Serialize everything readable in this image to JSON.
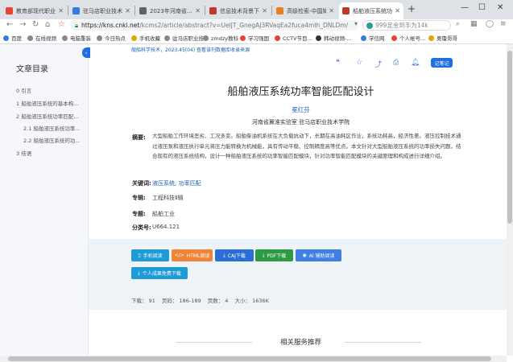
{
  "browser": {
    "tabs": [
      {
        "label": "教育部现代职业教...",
        "color": "#e94235"
      },
      {
        "label": "驻马店职业技术学...",
        "color": "#2f7de1"
      },
      {
        "label": "2023年河南省...",
        "color": "#5f6368"
      },
      {
        "label": "信息技术背景下船...",
        "color": "#c0392b"
      },
      {
        "label": "高级检索-中国知网",
        "color": "#e67e22"
      },
      {
        "label": "船舶液压系统功率...",
        "color": "#c0392b"
      }
    ],
    "new_tab": "+",
    "window_controls": {
      "minimize": "—",
      "maximize": "☐",
      "close": "✕"
    },
    "url_host": "https://kns.cnki.net",
    "url_path": "/kcms2/article/abstract?v=UelJT_GnegAJ3RVaqEa2fuca4mIh_DNLDm/",
    "search_placeholder": "999足金到手为14k",
    "bookmarks": [
      "百度",
      "在线视频",
      "电脑重装",
      "今日热点",
      "手机收藏",
      "驻马店职业技...",
      "zmdzy教科",
      "学习强国",
      "CCTV节目...",
      "韩动视频-...",
      "学信网",
      "个人帐号...",
      "奥瓊哥哥"
    ]
  },
  "sidebar": {
    "title": "文章目录",
    "toc": [
      {
        "label": "0 引言",
        "indent": 0
      },
      {
        "label": "1 船舶液压系统的基本构...",
        "indent": 0
      },
      {
        "label": "2 船舶液压系统功率匹配...",
        "indent": 0
      },
      {
        "label": "2.1 船舶液压系统功率...",
        "indent": 1
      },
      {
        "label": "2.2 船舶液压系统的功...",
        "indent": 1
      },
      {
        "label": "3 结语",
        "indent": 0
      }
    ],
    "collapse_icon": "‹"
  },
  "article": {
    "meta_line": "舰船科学技术，2023,45(04)  查看该刊数据库收录来源",
    "note_button": "记笔记",
    "title": "船舶液压系统功率智能匹配设计",
    "author": "冕红芬",
    "org": "河南省冀淮实验室    驻马店职业技术学院",
    "abstract_label": "摘要:",
    "abstract": "大型船舶工作环境恶劣、工况多变。船舶柴油机系统在大负载抗动下，长期在高油耗区作业，系统功耗高，经济性差。液压控制技术通过液压泵和液压执行单元将压力能转换为机械能，具有传动平稳、控制精度高等优点。本文针对大型船舶液压系统的功率损失问题，结合现有的液压系统结构，设计一种船舶液压系统的功率智能匹配模块，针对功率智能匹配模块的关键原理和构成进行详细介绍。",
    "keywords_label": "关键词:",
    "keywords": "液压系统;  功率匹配",
    "category_label": "专辑:",
    "category": "工程科技Ⅱ辑",
    "topic_label": "专题:",
    "topic": "船舶工业",
    "class_label": "分类号:",
    "class_no": "U664.121"
  },
  "downloads": {
    "buttons": [
      {
        "label": "手机阅读",
        "icon": "▯",
        "color": "#1e9ad6"
      },
      {
        "label": "HTML阅读",
        "icon": "</>",
        "color": "#f0853a"
      },
      {
        "label": "CAJ下载",
        "icon": "⤓",
        "color": "#2b6fd6"
      },
      {
        "label": "PDF下载",
        "icon": "⤓",
        "color": "#2f9a44"
      },
      {
        "label": "AI 辅助阅读",
        "icon": "◉",
        "color": "#3f7fe3"
      }
    ],
    "personal_button": {
      "label": "个人成果免费下载",
      "icon": "⤓",
      "color": "#1e9ad6"
    }
  },
  "stats": {
    "downloads": "下载： 91",
    "pages_range": "页码： 186-189",
    "page_count": "页数： 4",
    "size": "大小： 1636K"
  },
  "related": {
    "title": "相关服务推荐"
  }
}
